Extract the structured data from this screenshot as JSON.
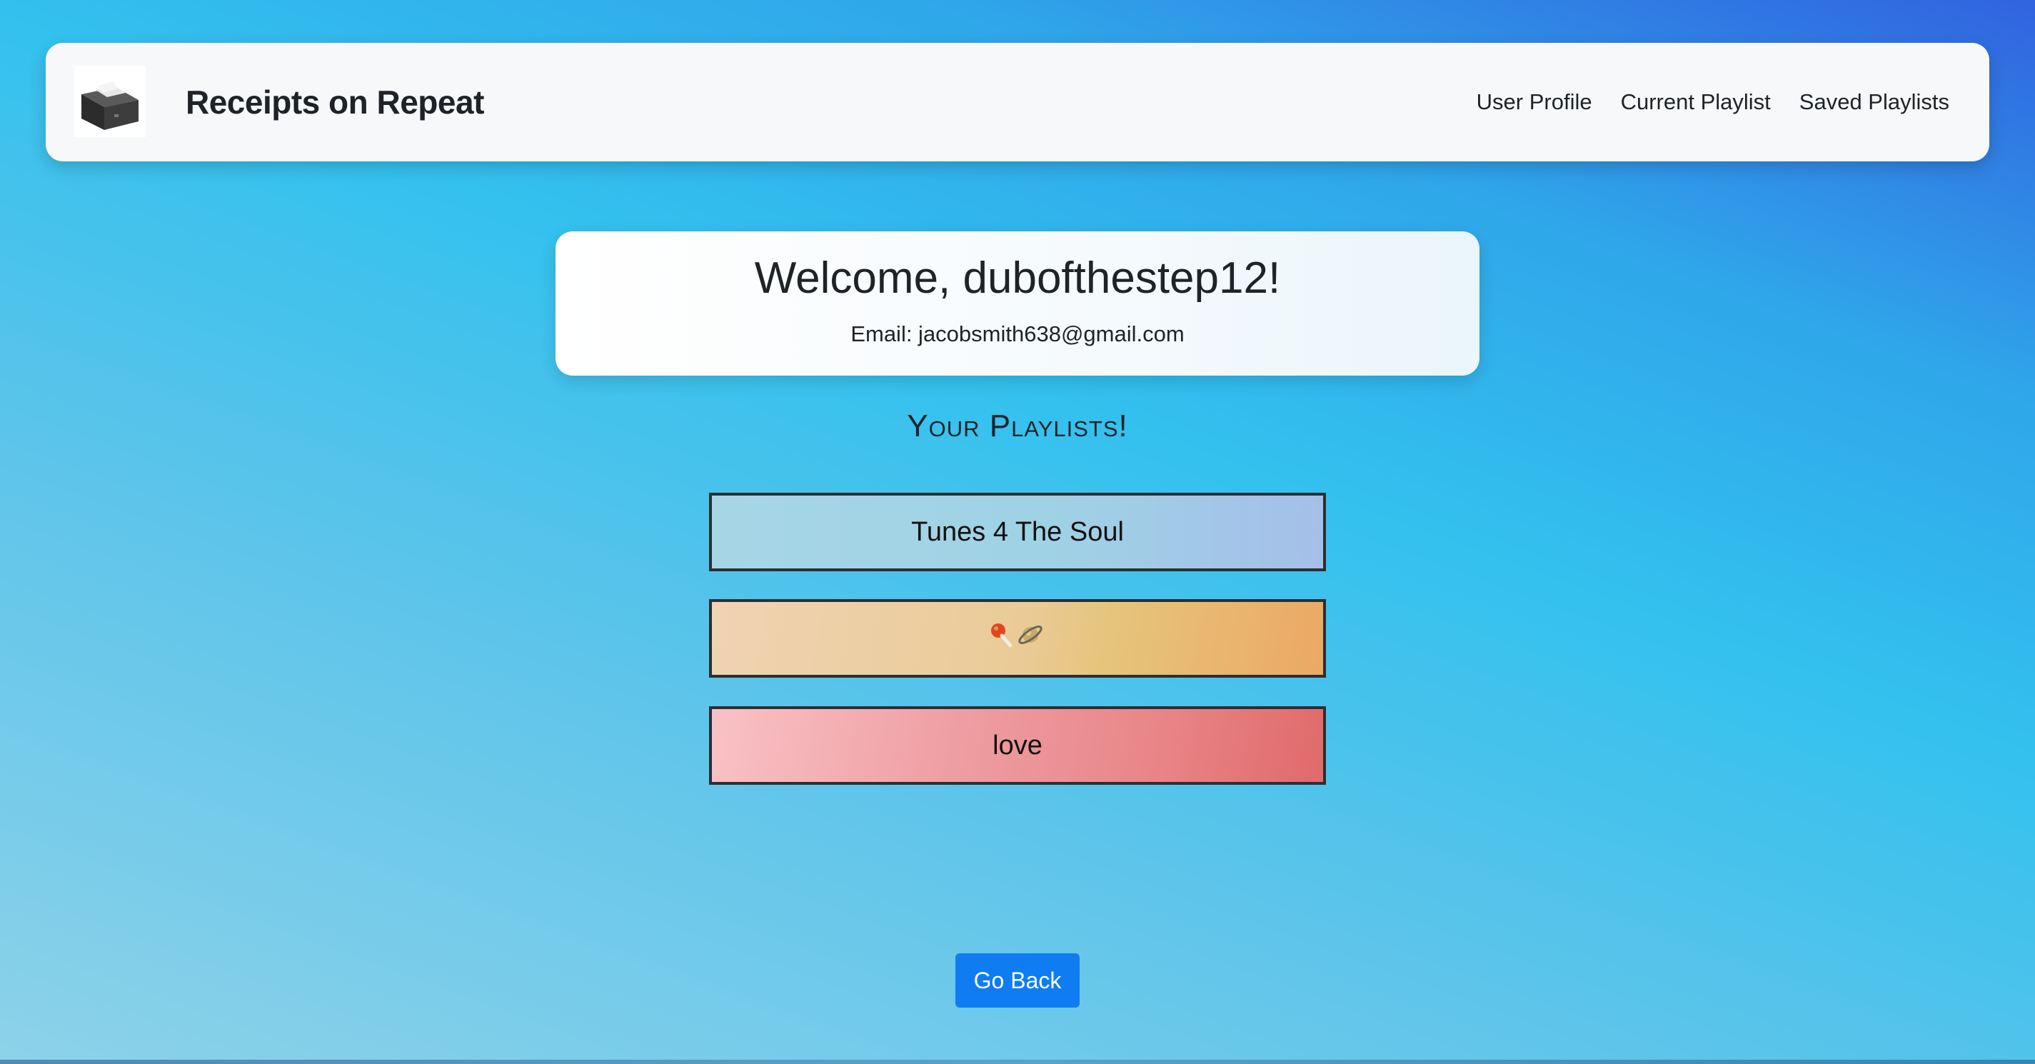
{
  "app": {
    "brand": "Receipts on Repeat",
    "logo_icon": "receipt-printer-icon"
  },
  "nav": {
    "links": [
      {
        "label": "User Profile"
      },
      {
        "label": "Current Playlist"
      },
      {
        "label": "Saved Playlists"
      }
    ]
  },
  "profile": {
    "welcome": "Welcome, dubofthestep12!",
    "email": "Email: jacobsmith638@gmail.com"
  },
  "playlists": {
    "heading": "Your Playlists!",
    "items": [
      {
        "label": "Tunes 4 The Soul"
      },
      {
        "label": "",
        "icons": [
          "lollipop-icon",
          "ringed-planet-icon"
        ]
      },
      {
        "label": "love"
      }
    ]
  },
  "actions": {
    "go_back": "Go Back"
  },
  "colors": {
    "button_primary": "#0f7cf2",
    "text": "#1f2328"
  }
}
